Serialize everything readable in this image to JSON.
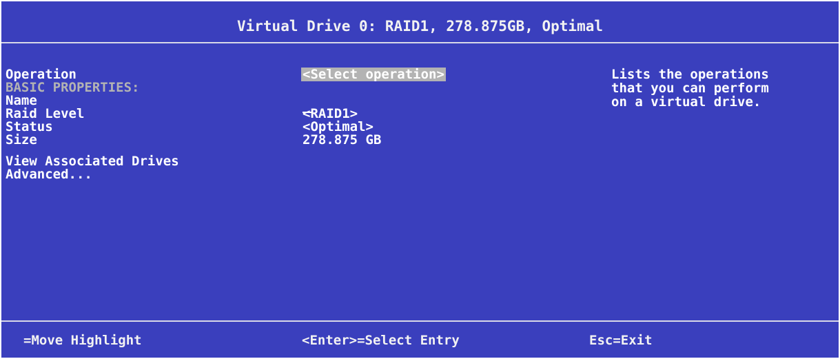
{
  "header": {
    "title": "Virtual Drive 0: RAID1, 278.875GB, Optimal"
  },
  "menu": {
    "operation_label": "Operation",
    "operation_value": "<Select operation>",
    "section_basic": "BASIC PROPERTIES:",
    "name_label": "Name",
    "name_value": "",
    "raid_level_label": "Raid Level",
    "raid_level_value": "<RAID1>",
    "status_label": "Status",
    "status_value": "<Optimal>",
    "size_label": "Size",
    "size_value": "278.875 GB",
    "view_drives_label": "View Associated Drives",
    "advanced_label": "Advanced..."
  },
  "help": {
    "text": "Lists the operations\nthat you can perform\non a virtual drive."
  },
  "footer": {
    "move_hint": "=Move Highlight",
    "enter_hint": "<Enter>=Select Entry",
    "esc_hint": "Esc=Exit"
  },
  "colors": {
    "background": "#3a3fbd",
    "text": "#ffffff",
    "dim_text": "#b3b3b3",
    "highlight": "#b3b3b3"
  }
}
